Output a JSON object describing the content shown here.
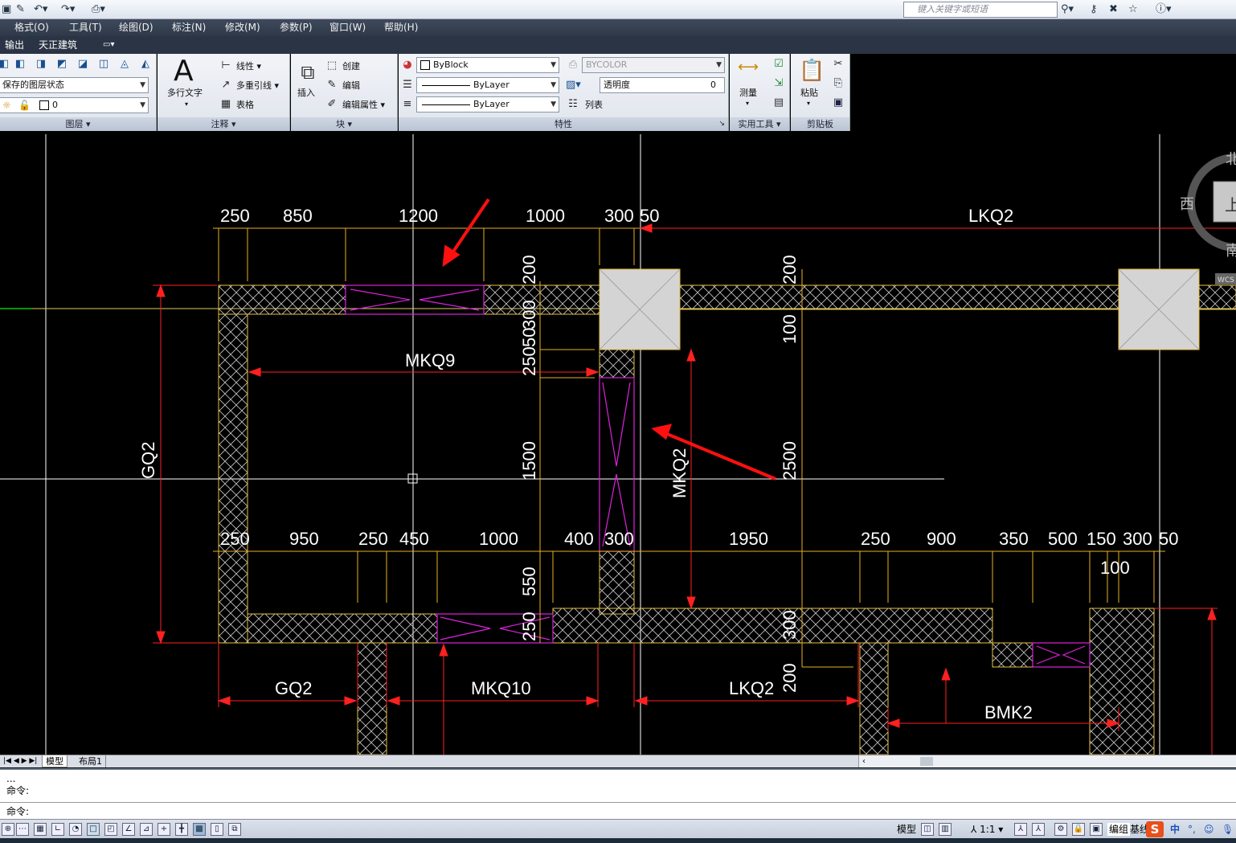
{
  "search": {
    "placeholder": "键入关键字或短语"
  },
  "menubar": [
    "格式(O)",
    "工具(T)",
    "绘图(D)",
    "标注(N)",
    "修改(M)",
    "参数(P)",
    "窗口(W)",
    "帮助(H)"
  ],
  "ribbon_tabs": [
    "输出",
    "天正建筑"
  ],
  "layers": {
    "state": "保存的图层状态",
    "current": "0",
    "title": "图层"
  },
  "annotation": {
    "mtext": "多行文字",
    "linear": "线性",
    "mleader": "多重引线",
    "table": "表格",
    "title": "注释"
  },
  "block": {
    "insert": "插入",
    "create": "创建",
    "edit": "编辑",
    "edit_attr": "编辑属性",
    "title": "块"
  },
  "properties": {
    "color": "ByBlock",
    "linetype": "ByLayer",
    "lineweight": "ByLayer",
    "plot_color": "BYCOLOR",
    "transparency_label": "透明度",
    "transparency_value": "0",
    "list": "列表",
    "title": "特性"
  },
  "utilities": {
    "measure": "测量",
    "title": "实用工具"
  },
  "clipboard": {
    "paste": "粘贴",
    "title": "剪贴板"
  },
  "viewcube": {
    "north": "北",
    "west": "西",
    "south": "南",
    "top": "上",
    "wcs": "WCS"
  },
  "drawing": {
    "top_dims": [
      "250",
      "850",
      "1200",
      "1000",
      "300",
      "50"
    ],
    "top_label": "LKQ2",
    "vert_dims_left": [
      "200",
      "300",
      "50",
      "250",
      "1500"
    ],
    "vert_dims_right": [
      "200",
      "100",
      "2500"
    ],
    "labels": {
      "mkq9": "MKQ9",
      "mkq2": "MKQ2",
      "gq2_side": "GQ2",
      "gq2_bottom": "GQ2",
      "mkq10": "MKQ10",
      "lkq2_bottom": "LKQ2",
      "bmk2": "BMK2"
    },
    "mid_dims": [
      "250",
      "950",
      "250",
      "450",
      "1000",
      "400",
      "300",
      "1950",
      "250",
      "900",
      "350",
      "500",
      "150",
      "300",
      "50"
    ],
    "mid_dim_sub": "100",
    "lower_vert_dims": [
      "550",
      "250",
      "300",
      "200"
    ]
  },
  "layout_tabs": {
    "model": "模型",
    "layout1": "布局1"
  },
  "command": {
    "line1": "...",
    "line2": "命令:",
    "prompt": "命令:"
  },
  "status": {
    "model": "模型",
    "scale": "1:1",
    "workspace": "编组",
    "base": "基线",
    "ime": "中"
  }
}
